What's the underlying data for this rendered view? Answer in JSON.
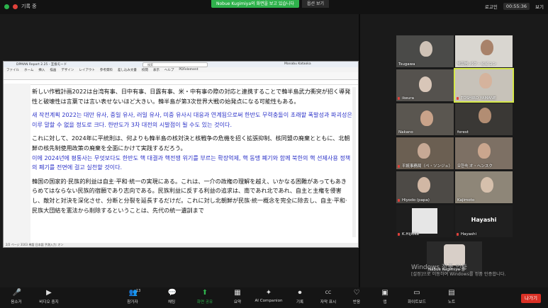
{
  "top": {
    "recording_label": "기록 중",
    "share_banner": "Nobue Kugimiya의 화면을 보고 있습니다",
    "view_option": "옵션 보기",
    "logo_label": "로고인",
    "timer": "00:55:36",
    "view_label": "보기"
  },
  "doc": {
    "window_title": "DPMAN Report 2.25 - 互換モード",
    "search_placeholder": "検索",
    "user": "Manabu Kataoka",
    "menu": [
      "ファイル",
      "ホーム",
      "挿入",
      "描画",
      "デザイン",
      "レイアウト",
      "参考資料",
      "差し込み文書",
      "校閲",
      "表示",
      "ヘルプ",
      "PDFelement"
    ],
    "paragraphs": [
      {
        "lang": "ja",
        "text": "新しい作戦計画2022は台湾有事、日中有事、日露有事、米・中有事の際の対応と連携することで韓半島武力衝突が招く導発性と破壊性は言葉では言い表せないほど大きい。韓半島が第3次世界大戦の始発点になる可能性もある。"
      },
      {
        "lang": "ko",
        "text": "새 작전계획 2022는 대만 유사, 중일 유사, 러일 유사, 미중 유사시 대응과 연계됨으로써 한반도 무력충돌이 초래할 폭발성과 파괴성은 이루 말할 수 없을 정도로 크다. 한반도가 3차 대전의 시발점이 될 수도 있는 것이다."
      },
      {
        "lang": "ja",
        "text": "これに対して、2024年に平統則は、何よりも韓半島の核対決と核戦争の危機を招く拡張抑制、核同盟の廃棄とともに、北朝鮮の核先制使用政策の廃棄を全面にかけて実践するだろう。"
      },
      {
        "lang": "ko",
        "text": "이에 2024년에 평통사는 무엇보다도 한반도 핵 대결과 핵전쟁 위기를 부르는 확장억제, 핵 동맹 폐기와 함께 북한의 핵 선제사용 정책의 폐기를 전면에 걸고 실천할 것이다."
      },
      {
        "lang": "ja",
        "text": "韓国の国家的·民族的利益は自主·平和·統一の実現にある。これは、一介の政権の理解を越え、いかなる困難があってもあきらめてはならない民族的宿願であり志向である。民族利益に反する利益の追求は、南であれ北であれ、自主と主権を侵害し、敵対と対決を深化させ、分断と分裂を延長するだけだ。これに対し北朝鮮が民族·統一概念を完全に除去し、自主·平和·民族大団結を憲法から削除するということは、先代の統一遺訓まで"
      }
    ],
    "status": "2/2 ページ   3163 単語   日本語   予測入力: オン"
  },
  "gallery": [
    {
      "name": "Tsugawa"
    },
    {
      "name": "박희병 パク・ヒビョン"
    },
    {
      "name": "ikeura"
    },
    {
      "name": "TOSHIRO YAMANE"
    },
    {
      "name": "Nakano"
    },
    {
      "name": "forest"
    },
    {
      "name": "平統事務局（ペ・ソンジュ）"
    },
    {
      "name": "오한숙 オ・ヘンスク"
    },
    {
      "name": "Hiyodo (papa)"
    },
    {
      "name": "Kajimoto"
    },
    {
      "name": "K.Hijioka"
    },
    {
      "name": "Hayashi"
    }
  ],
  "hayashi_big": "Hayashi",
  "nabue_tile": {
    "name": "Nabue Kugimiya 중"
  },
  "windows_activate": {
    "line1": "Windows 정품 인증",
    "line2": "[설정]으로 이동하여 Windows를 정품 인증합니다."
  },
  "toolbar": [
    {
      "label": "음소거",
      "icon": "🎤"
    },
    {
      "label": "비디오 중지",
      "icon": "▶"
    },
    {
      "label": "참가자",
      "icon": "👥",
      "count": "13"
    },
    {
      "label": "채팅",
      "icon": "💬"
    },
    {
      "label": "화면 공유",
      "icon": "⬆"
    },
    {
      "label": "요약",
      "icon": "▦"
    },
    {
      "label": "AI Companion",
      "icon": "✦"
    },
    {
      "label": "기록",
      "icon": "⏺"
    },
    {
      "label": "자막 표시",
      "icon": "CC"
    },
    {
      "label": "반응",
      "icon": "♡"
    },
    {
      "label": "앱",
      "icon": "▣"
    },
    {
      "label": "화이트보드",
      "icon": "▭"
    },
    {
      "label": "노트",
      "icon": "▤"
    }
  ],
  "leave_label": "나가기",
  "colors": {
    "share_green": "#2fb24c",
    "korean_text": "#2b32c8",
    "leave_red": "#d93025"
  }
}
